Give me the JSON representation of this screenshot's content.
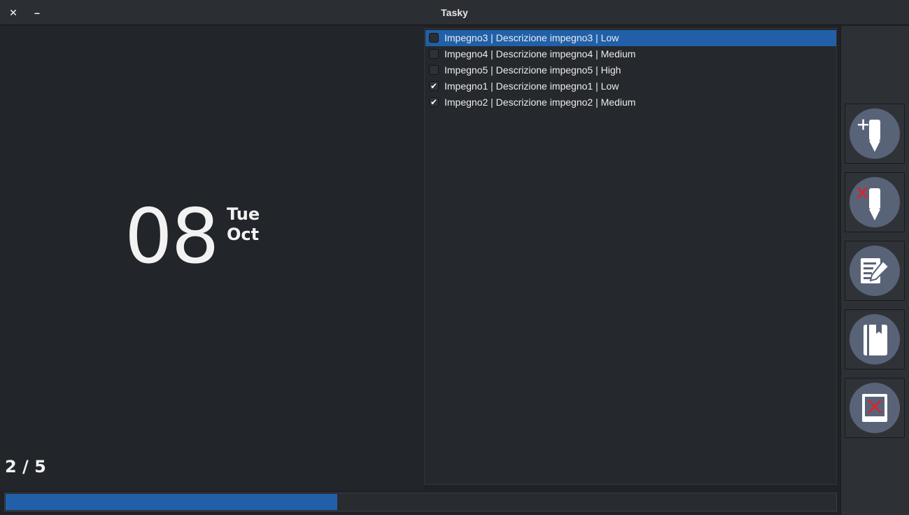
{
  "window": {
    "title": "Tasky",
    "close_glyph": "✕",
    "minimize_glyph": "–"
  },
  "date": {
    "day": "08",
    "weekday": "Tue",
    "month": "Oct"
  },
  "counter": {
    "text": "2 / 5",
    "done": 2,
    "total": 5
  },
  "progress": {
    "fraction": 0.4
  },
  "tasks": [
    {
      "label": "Impegno3 | Descrizione impegno3 | Low",
      "checked": false,
      "selected": true
    },
    {
      "label": "Impegno4 | Descrizione impegno4 | Medium",
      "checked": false,
      "selected": false
    },
    {
      "label": "Impegno5 | Descrizione impegno5 | High",
      "checked": false,
      "selected": false
    },
    {
      "label": "Impegno1 | Descrizione impegno1 | Low",
      "checked": true,
      "selected": false
    },
    {
      "label": "Impegno2 | Descrizione impegno2 | Medium",
      "checked": true,
      "selected": false
    }
  ],
  "toolbar": [
    {
      "icon": "add-task-icon"
    },
    {
      "icon": "delete-task-icon"
    },
    {
      "icon": "edit-task-icon"
    },
    {
      "icon": "notebook-icon"
    },
    {
      "icon": "close-app-icon"
    }
  ],
  "colors": {
    "accent": "#2160a8",
    "icon_circle": "#596377",
    "delete_mark": "#e0202a"
  }
}
